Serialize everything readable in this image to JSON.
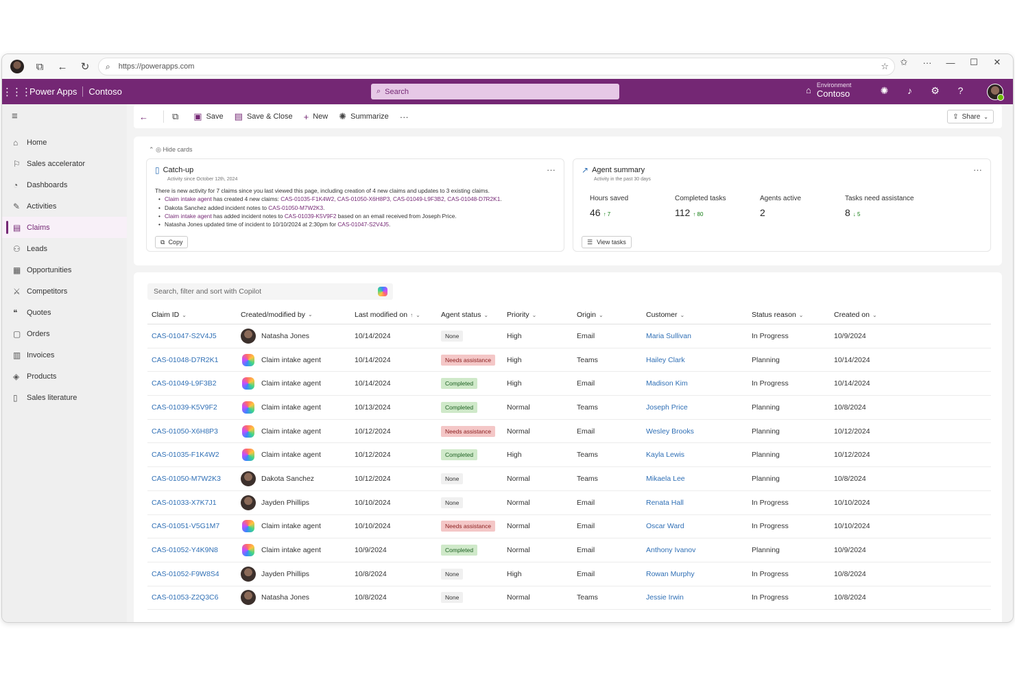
{
  "browser": {
    "url": "https://powerapps.com"
  },
  "app": {
    "name": "Power Apps",
    "org": "Contoso",
    "search_placeholder": "Search",
    "environment_label": "Environment",
    "environment_value": "Contoso"
  },
  "sidebar": {
    "items": [
      {
        "label": "Home",
        "icon": "home-icon"
      },
      {
        "label": "Sales accelerator",
        "icon": "rocket-icon"
      },
      {
        "label": "Dashboards",
        "icon": "dashboard-icon"
      },
      {
        "label": "Activities",
        "icon": "activities-icon"
      },
      {
        "label": "Claims",
        "icon": "document-icon",
        "active": true
      },
      {
        "label": "Leads",
        "icon": "people-icon"
      },
      {
        "label": "Opportunities",
        "icon": "briefcase-icon"
      },
      {
        "label": "Competitors",
        "icon": "competitors-icon"
      },
      {
        "label": "Quotes",
        "icon": "quotes-icon"
      },
      {
        "label": "Orders",
        "icon": "orders-icon"
      },
      {
        "label": "Invoices",
        "icon": "invoices-icon"
      },
      {
        "label": "Products",
        "icon": "box-icon"
      },
      {
        "label": "Sales literature",
        "icon": "literature-icon"
      }
    ]
  },
  "toolbar": {
    "save": "Save",
    "save_close": "Save & Close",
    "new": "New",
    "summarize": "Summarize",
    "share": "Share"
  },
  "cards": {
    "hide_label": "Hide cards",
    "catchup": {
      "title": "Catch-up",
      "subtitle": "Activity since October 12th, 2024",
      "intro": "There is new activity for 7 claims since you last viewed this page, including creation of 4 new claims and updates to 3 existing claims.",
      "b1_actor": "Claim intake agent",
      "b1_text": " has created 4 new claims: ",
      "b1_claims": "CAS-01035-F1K4W2, CAS-01050-X6H8P3, CAS-01049-L9F3B2, CAS-01048-D7R2K1",
      "b1_end": ".",
      "b2_text": "Dakota Sanchez added incident notes to ",
      "b2_claim": "CAS-01050-M7W2K3",
      "b2_end": ".",
      "b3_actor": "Claim intake agent",
      "b3_text": " has added incident notes to ",
      "b3_claim": "CAS-01039-K5V9F2",
      "b3_end": " based on an email received from Joseph Price.",
      "b4_text": "Natasha Jones updated time of incident to 10/10/2024 at 2:30pm for ",
      "b4_claim": "CAS-01047-S2V4J5",
      "b4_end": ".",
      "copy": "Copy"
    },
    "agent": {
      "title": "Agent summary",
      "subtitle": "Activity in the past 30 days",
      "metrics": [
        {
          "label": "Hours saved",
          "value": "46",
          "delta": "↑ 7",
          "dir": "up"
        },
        {
          "label": "Completed tasks",
          "value": "112",
          "delta": "↑ 80",
          "dir": "up"
        },
        {
          "label": "Agents active",
          "value": "2",
          "delta": "",
          "dir": ""
        },
        {
          "label": "Tasks need assistance",
          "value": "8",
          "delta": "↓ 5",
          "dir": "down"
        }
      ],
      "view_tasks": "View tasks"
    }
  },
  "grid": {
    "search_placeholder": "Search, filter and sort with Copilot",
    "columns": [
      "Claim ID",
      "Created/modified by",
      "Last modified on",
      "Agent status",
      "Priority",
      "Origin",
      "Customer",
      "Status reason",
      "Created on"
    ],
    "rows": [
      {
        "id": "CAS-01047-S2V4J5",
        "by": "Natasha Jones",
        "type": "person",
        "modified": "10/14/2024",
        "status": "None",
        "priority": "High",
        "origin": "Email",
        "customer": "Maria Sullivan",
        "reason": "In Progress",
        "created": "10/9/2024"
      },
      {
        "id": "CAS-01048-D7R2K1",
        "by": "Claim intake agent",
        "type": "agent",
        "modified": "10/14/2024",
        "status": "Needs assistance",
        "priority": "High",
        "origin": "Teams",
        "customer": "Hailey Clark",
        "reason": "Planning",
        "created": "10/14/2024"
      },
      {
        "id": "CAS-01049-L9F3B2",
        "by": "Claim intake agent",
        "type": "agent",
        "modified": "10/14/2024",
        "status": "Completed",
        "priority": "High",
        "origin": "Email",
        "customer": "Madison Kim",
        "reason": "In Progress",
        "created": "10/14/2024"
      },
      {
        "id": "CAS-01039-K5V9F2",
        "by": "Claim intake agent",
        "type": "agent",
        "modified": "10/13/2024",
        "status": "Completed",
        "priority": "Normal",
        "origin": "Teams",
        "customer": "Joseph Price",
        "reason": "Planning",
        "created": "10/8/2024"
      },
      {
        "id": "CAS-01050-X6H8P3",
        "by": "Claim intake agent",
        "type": "agent",
        "modified": "10/12/2024",
        "status": "Needs assistance",
        "priority": "Normal",
        "origin": "Email",
        "customer": "Wesley Brooks",
        "reason": "Planning",
        "created": "10/12/2024"
      },
      {
        "id": "CAS-01035-F1K4W2",
        "by": "Claim intake agent",
        "type": "agent",
        "modified": "10/12/2024",
        "status": "Completed",
        "priority": "High",
        "origin": "Teams",
        "customer": "Kayla Lewis",
        "reason": "Planning",
        "created": "10/12/2024"
      },
      {
        "id": "CAS-01050-M7W2K3",
        "by": "Dakota Sanchez",
        "type": "person",
        "modified": "10/12/2024",
        "status": "None",
        "priority": "Normal",
        "origin": "Teams",
        "customer": "Mikaela Lee",
        "reason": "Planning",
        "created": "10/8/2024"
      },
      {
        "id": "CAS-01033-X7K7J1",
        "by": "Jayden Phillips",
        "type": "person",
        "modified": "10/10/2024",
        "status": "None",
        "priority": "Normal",
        "origin": "Email",
        "customer": "Renata Hall",
        "reason": "In Progress",
        "created": "10/10/2024"
      },
      {
        "id": "CAS-01051-V5G1M7",
        "by": "Claim intake agent",
        "type": "agent",
        "modified": "10/10/2024",
        "status": "Needs assistance",
        "priority": "Normal",
        "origin": "Email",
        "customer": "Oscar Ward",
        "reason": "In Progress",
        "created": "10/10/2024"
      },
      {
        "id": "CAS-01052-Y4K9N8",
        "by": "Claim intake agent",
        "type": "agent",
        "modified": "10/9/2024",
        "status": "Completed",
        "priority": "Normal",
        "origin": "Email",
        "customer": "Anthony Ivanov",
        "reason": "Planning",
        "created": "10/9/2024"
      },
      {
        "id": "CAS-01052-F9W8S4",
        "by": "Jayden Phillips",
        "type": "person",
        "modified": "10/8/2024",
        "status": "None",
        "priority": "High",
        "origin": "Email",
        "customer": "Rowan Murphy",
        "reason": "In Progress",
        "created": "10/8/2024"
      },
      {
        "id": "CAS-01053-Z2Q3C6",
        "by": "Natasha Jones",
        "type": "person",
        "modified": "10/8/2024",
        "status": "None",
        "priority": "Normal",
        "origin": "Teams",
        "customer": "Jessie Irwin",
        "reason": "In Progress",
        "created": "10/8/2024"
      }
    ]
  },
  "colors": {
    "brand": "#742774",
    "link": "#2f6fb5",
    "needs_assistance": "#f4c7c7",
    "completed": "#cfe9c9"
  }
}
